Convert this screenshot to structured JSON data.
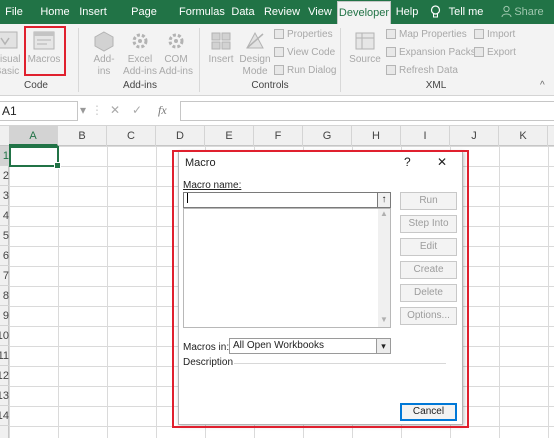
{
  "ribbon_tabs": {
    "file": "File",
    "home": "Home",
    "insert": "Insert",
    "page_layout": "Page Layout",
    "formulas": "Formulas",
    "data": "Data",
    "review": "Review",
    "view": "View",
    "developer": "Developer",
    "help": "Help",
    "tell_me": "Tell me",
    "share": "Share"
  },
  "ribbon": {
    "code": {
      "visual_basic_1": "Visual",
      "visual_basic_2": "Basic",
      "macros": "Macros",
      "group": "Code"
    },
    "addins": {
      "addins_1": "Add-",
      "addins_2": "ins",
      "excel_addins_1": "Excel",
      "excel_addins_2": "Add-ins",
      "com_addins_1": "COM",
      "com_addins_2": "Add-ins",
      "group": "Add-ins"
    },
    "controls": {
      "insert": "Insert",
      "design_mode_1": "Design",
      "design_mode_2": "Mode",
      "properties": "Properties",
      "view_code": "View Code",
      "run_dialog": "Run Dialog",
      "group": "Controls"
    },
    "xml": {
      "source": "Source",
      "map_properties": "Map Properties",
      "expansion_packs": "Expansion Packs",
      "refresh_data": "Refresh Data",
      "import": "Import",
      "export": "Export",
      "group": "XML"
    }
  },
  "formula_bar": {
    "name_box": "A1",
    "cancel": "✕",
    "enter": "✓",
    "fx": "fx",
    "formula": ""
  },
  "columns": [
    "A",
    "B",
    "C",
    "D",
    "E",
    "F",
    "G",
    "H",
    "I",
    "J",
    "K"
  ],
  "rows": [
    "1",
    "2",
    "3",
    "4",
    "5",
    "6",
    "7",
    "8",
    "9",
    "10",
    "11",
    "12",
    "13",
    "14"
  ],
  "dialog": {
    "title": "Macro",
    "help": "?",
    "close": "✕",
    "macro_name_label": "Macro name:",
    "macro_name_value": "",
    "macros_in_label": "Macros in:",
    "macros_in_value": "All Open Workbooks",
    "description_label": "Description",
    "buttons": {
      "run": "Run",
      "step_into": "Step Into",
      "edit": "Edit",
      "create": "Create",
      "delete": "Delete",
      "options": "Options...",
      "cancel": "Cancel"
    }
  },
  "colors": {
    "excel_green": "#217346",
    "highlight": "#e0202e",
    "focus_blue": "#0078d7"
  },
  "icons": [
    "lightbulb-icon",
    "person-icon",
    "visual-basic-icon",
    "macros-icon",
    "addins-icon",
    "excel-addins-icon",
    "com-addins-icon",
    "insert-control-icon",
    "design-mode-icon",
    "properties-icon",
    "view-code-icon",
    "run-dialog-icon",
    "source-icon",
    "map-properties-icon",
    "expansion-packs-icon",
    "refresh-data-icon",
    "import-icon",
    "export-icon",
    "cancel-icon",
    "enter-icon",
    "function-icon",
    "close-icon",
    "help-icon",
    "upload-arrow-icon",
    "scroll-up-icon",
    "scroll-down-icon",
    "dropdown-arrow-icon"
  ]
}
